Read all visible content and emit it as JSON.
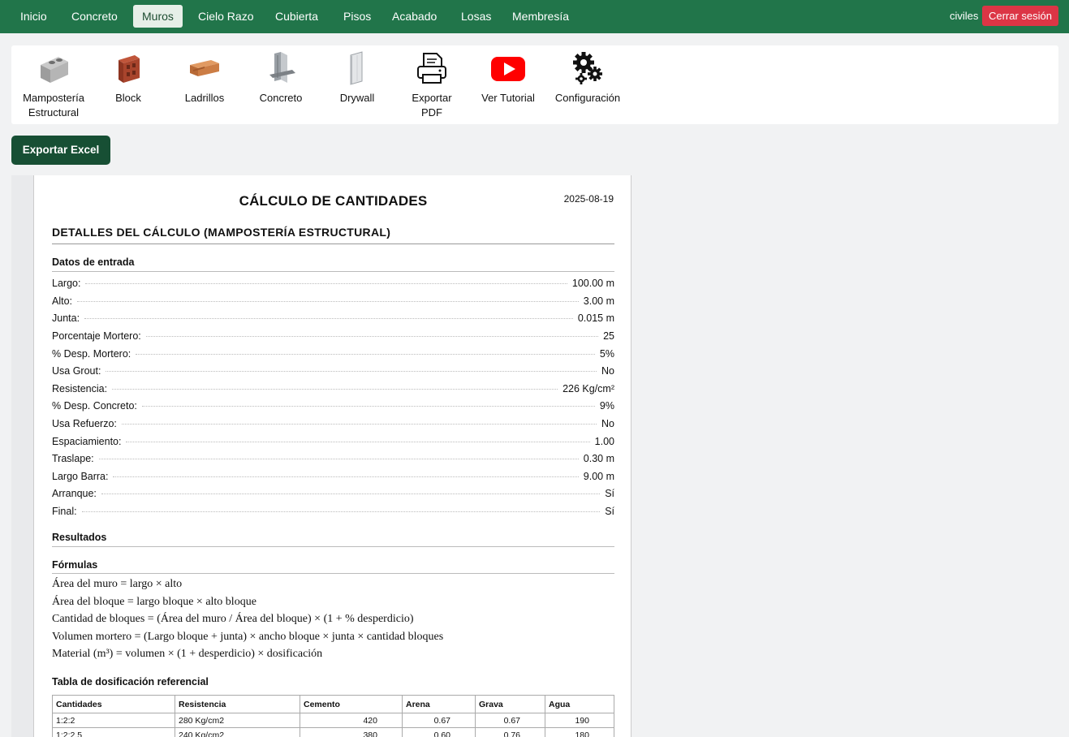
{
  "nav": {
    "tabs": [
      "Inicio",
      "Concreto",
      "Muros",
      "Cielo Razo",
      "Cubierta",
      "Pisos",
      "Acabado",
      "Losas",
      "Membresía"
    ],
    "active": "Muros",
    "user": "civiles",
    "logout_label": "Cerrar sesión"
  },
  "toolbar": {
    "items": [
      {
        "label_1": "Mampostería",
        "label_2": "Estructural",
        "icon": "cinder-block-icon"
      },
      {
        "label_1": "Block",
        "label_2": "",
        "icon": "clay-block-icon"
      },
      {
        "label_1": "Ladrillos",
        "label_2": "",
        "icon": "brick-icon"
      },
      {
        "label_1": "Concreto",
        "label_2": "",
        "icon": "concrete-wall-icon"
      },
      {
        "label_1": "Drywall",
        "label_2": "",
        "icon": "drywall-panel-icon"
      },
      {
        "label_1": "Exportar",
        "label_2": "PDF",
        "icon": "printer-icon"
      },
      {
        "label_1": "Ver Tutorial",
        "label_2": "",
        "icon": "youtube-icon"
      },
      {
        "label_1": "Configuración",
        "label_2": "",
        "icon": "gears-icon"
      }
    ]
  },
  "export_excel_label": "Exportar Excel",
  "report": {
    "title": "CÁLCULO DE CANTIDADES",
    "date": "2025-08-19",
    "subtitle": "DETALLES DEL CÁLCULO (MAMPOSTERÍA ESTRUCTURAL)",
    "inputs_heading": "Datos de entrada",
    "inputs": [
      {
        "label": "Largo:",
        "value": "100.00 m"
      },
      {
        "label": "Alto:",
        "value": "3.00 m"
      },
      {
        "label": "Junta:",
        "value": "0.015 m"
      },
      {
        "label": "Porcentaje Mortero:",
        "value": "25"
      },
      {
        "label": "% Desp. Mortero:",
        "value": "5%"
      },
      {
        "label": "Usa Grout:",
        "value": "No"
      },
      {
        "label": "Resistencia:",
        "value": "226 Kg/cm²"
      },
      {
        "label": "% Desp. Concreto:",
        "value": "9%"
      },
      {
        "label": "Usa Refuerzo:",
        "value": "No"
      },
      {
        "label": "Espaciamiento:",
        "value": "1.00"
      },
      {
        "label": "Traslape:",
        "value": "0.30 m"
      },
      {
        "label": "Largo Barra:",
        "value": "9.00 m"
      },
      {
        "label": "Arranque:",
        "value": "Sí"
      },
      {
        "label": "Final:",
        "value": "Sí"
      }
    ],
    "results_heading": "Resultados",
    "formulas_heading": "Fórmulas",
    "formulas": [
      "Área del muro = largo × alto",
      "Área del bloque = largo bloque × alto bloque",
      "Cantidad de bloques = (Área del muro / Área del bloque) × (1 + % desperdicio)",
      "Volumen mortero = (Largo bloque + junta) × ancho bloque × junta × cantidad bloques",
      "Material (m³) = volumen × (1 + desperdicio) × dosificación"
    ],
    "table_heading": "Tabla de dosificación referencial",
    "table": {
      "headers": [
        "Cantidades",
        "Resistencia",
        "Cemento",
        "Arena",
        "Grava",
        "Agua"
      ],
      "rows": [
        [
          "1:2:2",
          "280 Kg/cm2",
          "420",
          "0.67",
          "0.67",
          "190"
        ],
        [
          "1:2:2.5",
          "240 Kg/cm2",
          "380",
          "0.60",
          "0.76",
          "180"
        ]
      ]
    }
  }
}
